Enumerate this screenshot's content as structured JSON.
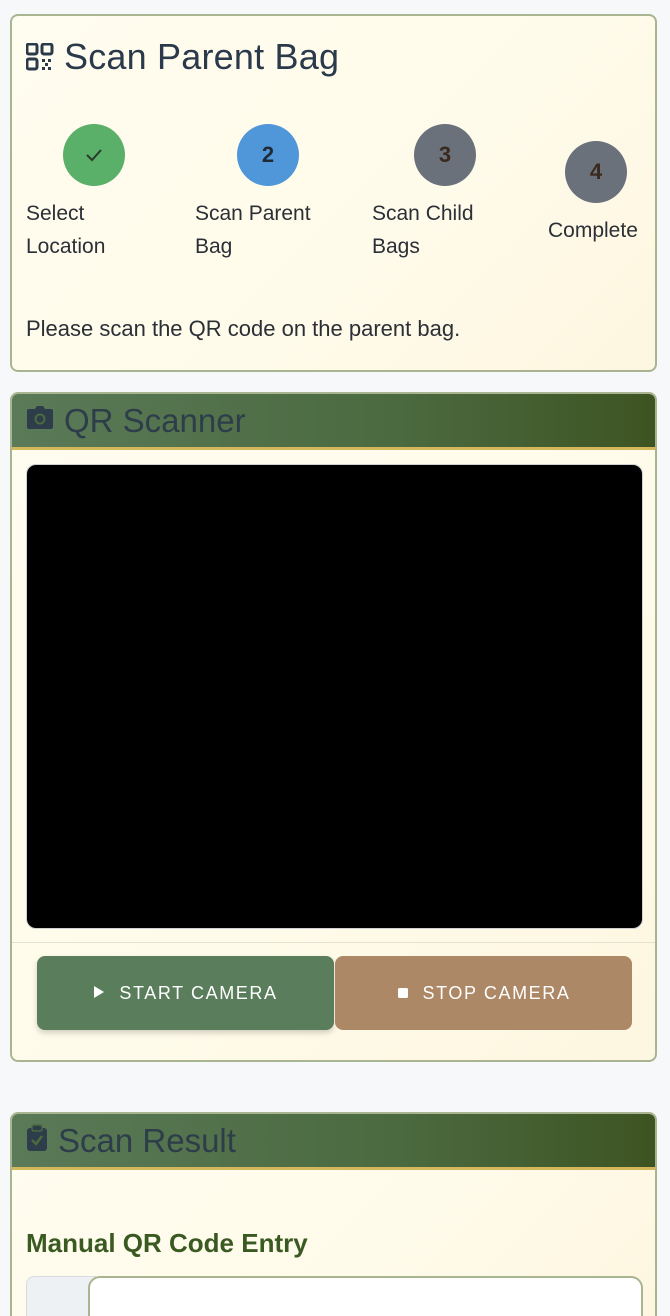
{
  "header": {
    "title": "Scan Parent Bag",
    "icon": "qrcode-icon"
  },
  "steps": [
    {
      "number": "✓",
      "label_line1": "Select",
      "label_line2": "Location",
      "state": "done",
      "color": "#5aaf69"
    },
    {
      "number": "2",
      "label_line1": "Scan Parent",
      "label_line2": "Bag",
      "state": "active",
      "color": "#4f97d8"
    },
    {
      "number": "3",
      "label_line1": "Scan Child",
      "label_line2": "Bags",
      "state": "pending",
      "color": "#6b717a"
    },
    {
      "number": "4",
      "label_line1": "Complete",
      "label_line2": "",
      "state": "pending",
      "color": "#6b717a"
    }
  ],
  "instruction": "Please scan the QR code on the parent bag.",
  "scanner": {
    "title": "QR Scanner",
    "icon": "camera-icon",
    "start_label": "START CAMERA",
    "stop_label": "STOP CAMERA"
  },
  "result": {
    "title": "Scan Result",
    "icon": "clipboard-check-icon",
    "manual_entry_title": "Manual QR Code Entry"
  },
  "colors": {
    "card_border": "#a9b591",
    "header_green": "#4b6a40",
    "header_underline": "#d4b75a",
    "start_button": "#5a7d5c",
    "stop_button": "#ad8866"
  }
}
